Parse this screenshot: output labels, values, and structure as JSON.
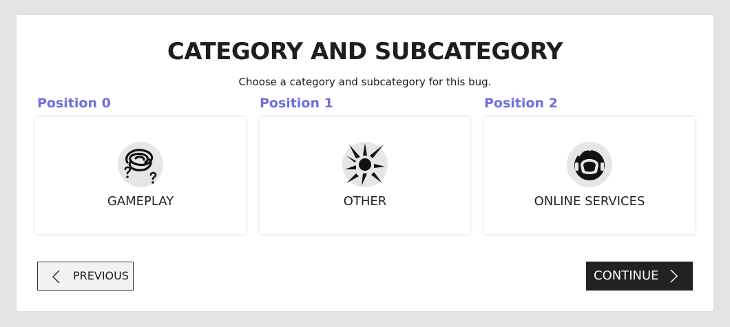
{
  "page": {
    "title": "CATEGORY AND SUBCATEGORY",
    "subtitle": "Choose a category and subcategory for this bug."
  },
  "categories": [
    {
      "position_label": "Position 0",
      "label": "GAMEPLAY",
      "icon": "confused-question-icon"
    },
    {
      "position_label": "Position 1",
      "label": "OTHER",
      "icon": "burst-icon"
    },
    {
      "position_label": "Position 2",
      "label": "ONLINE SERVICES",
      "icon": "headset-icon"
    }
  ],
  "buttons": {
    "previous": "PREVIOUS",
    "continue": "CONTINUE"
  },
  "colors": {
    "position_label": "#6f6fe0",
    "continue_bg": "#222222",
    "previous_bg": "#f2f2f2",
    "icon_circle": "#e6e6e6",
    "background": "#e3e3e3"
  }
}
